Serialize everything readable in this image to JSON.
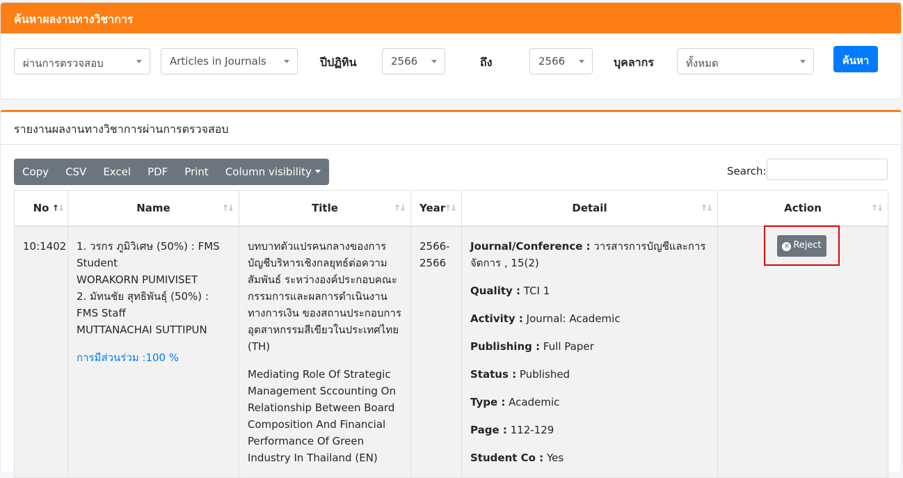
{
  "filter_card": {
    "title": "ค้นหาผลงานทางวิชาการ",
    "status_select": "ผ่านการตรวจสอบ",
    "type_select": "Articles in Journals",
    "year_label": "ปีปฏิทิน",
    "year_from": "2566",
    "to_label": "ถึง",
    "year_to": "2566",
    "person_label": "บุคลากร",
    "person_select": "ทั้งหมด",
    "search_button": "ค้นหา"
  },
  "report_card": {
    "title": "รายงานผลงานทางวิชาการผ่านการตรวจสอบ",
    "toolbar": [
      "Copy",
      "CSV",
      "Excel",
      "PDF",
      "Print",
      "Column visibility"
    ],
    "search_label": "Search:",
    "columns": [
      "No",
      "Name",
      "Title",
      "Year",
      "Detail",
      "Action"
    ],
    "row": {
      "no": "10:1402",
      "name_lines": [
        "1. วรกร ภูมิวิเศษ (50%) : FMS Student",
        "WORAKORN PUMIVISET",
        "2. มัทนชัย สุทธิพันธุ์ (50%) : FMS Staff",
        "MUTTANACHAI SUTTIPUN"
      ],
      "contribution": "การมีส่วนร่วม :100 %",
      "title_th": "บทบาทตัวแปรคนกลางของการบัญชีบริหารเชิงกลยุทธ์ต่อความสัมพันธ์ ระหว่างองค์ประกอบคณะกรรมการและผลการดำเนินงานทางการเงิน ของสถานประกอบการอุตสาหกรรมสีเขียวในประเทศไทย (TH)",
      "title_en": "Mediating Role Of Strategic Management Sccounting On Relationship Between Board Composition And Financial Performance Of Green Industry In Thailand (EN)",
      "year": "2566-2566",
      "details": [
        {
          "k": "Journal/Conference :",
          "v": " วารสารการบัญชีและการจัดการ , 15(2)"
        },
        {
          "k": "Quality :",
          "v": " TCI 1"
        },
        {
          "k": "Activity :",
          "v": " Journal: Academic"
        },
        {
          "k": "Publishing :",
          "v": " Full Paper"
        },
        {
          "k": "Status :",
          "v": " Published"
        },
        {
          "k": "Type :",
          "v": " Academic"
        },
        {
          "k": "Page :",
          "v": " 112-129"
        },
        {
          "k": "Student Co :",
          "v": " Yes"
        }
      ],
      "action": "Reject"
    }
  }
}
